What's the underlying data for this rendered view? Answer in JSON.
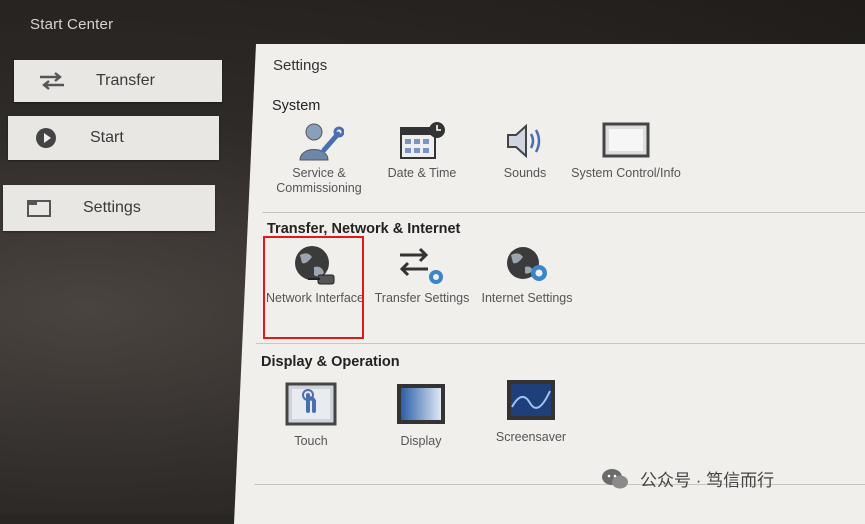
{
  "window": {
    "title": "Start Center"
  },
  "sidebar": {
    "items": [
      {
        "label": "Transfer",
        "icon": "transfer-arrows-icon"
      },
      {
        "label": "Start",
        "icon": "play-icon"
      },
      {
        "label": "Settings",
        "icon": "folder-icon"
      }
    ]
  },
  "main": {
    "title": "Settings",
    "sections": [
      {
        "title": "System",
        "items": [
          {
            "label": "Service & Commissioning",
            "icon": "service-person-wrench-icon"
          },
          {
            "label": "Date & Time",
            "icon": "calendar-clock-icon"
          },
          {
            "label": "Sounds",
            "icon": "speaker-icon"
          },
          {
            "label": "System Control/Info",
            "icon": "monitor-icon"
          }
        ]
      },
      {
        "title": "Transfer, Network & Internet",
        "items": [
          {
            "label": "Network Interface",
            "icon": "globe-network-icon"
          },
          {
            "label": "Transfer Settings",
            "icon": "transfer-gear-icon"
          },
          {
            "label": "Internet Settings",
            "icon": "globe-gear-icon"
          }
        ]
      },
      {
        "title": "Display & Operation",
        "items": [
          {
            "label": "Touch",
            "icon": "touch-hand-icon"
          },
          {
            "label": "Display",
            "icon": "display-screen-icon"
          },
          {
            "label": "Screensaver",
            "icon": "screensaver-icon"
          }
        ]
      }
    ]
  },
  "annotation": {
    "highlight_color": "#e0191a"
  },
  "watermark": {
    "text": "公众号 · 笃信而行",
    "icon": "wechat-icon"
  }
}
